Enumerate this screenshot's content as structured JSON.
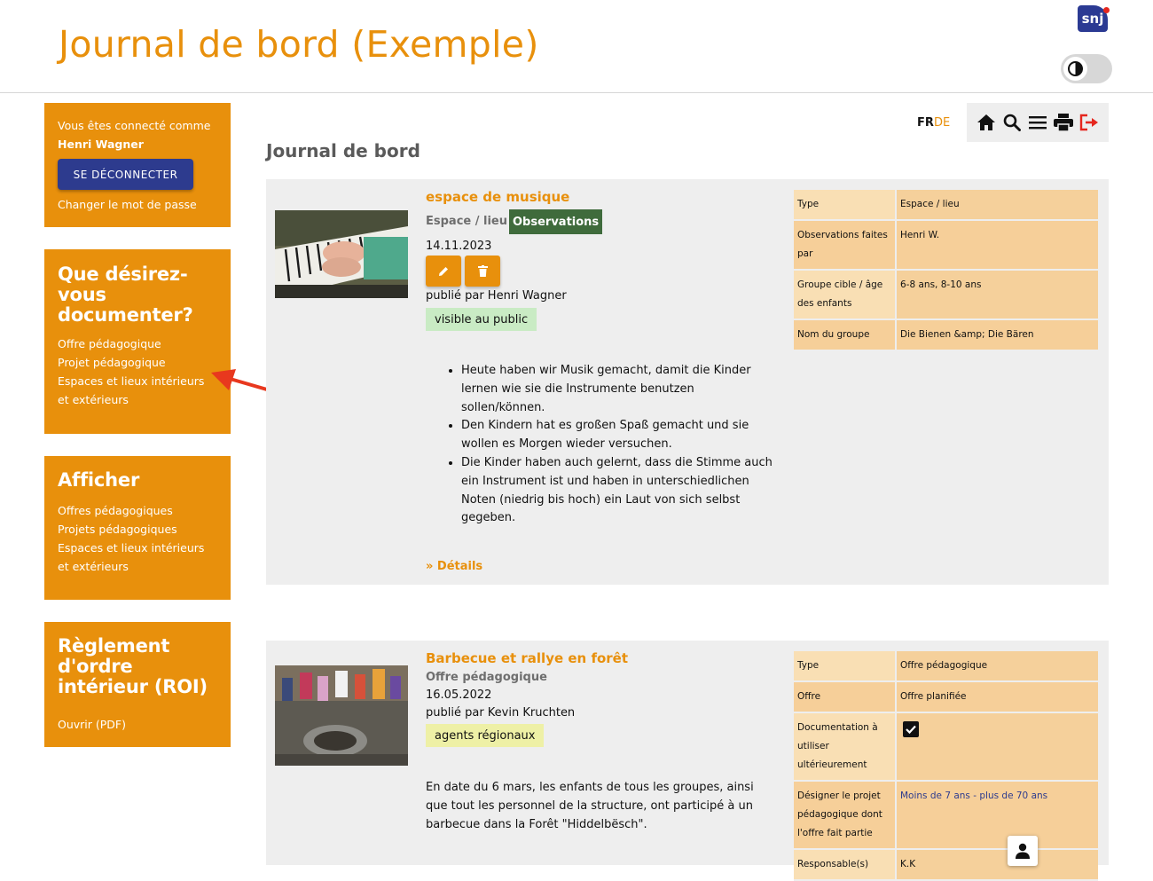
{
  "header": {
    "title": "Journal de bord (Exemple)",
    "logo_text": "snj"
  },
  "sidebar": {
    "login": {
      "line1": "Vous êtes connecté comme",
      "user": "Henri Wagner",
      "logout_label": "SE DÉCONNECTER",
      "change_password": "Changer le mot de passe"
    },
    "document_box": {
      "title": "Que désirez-vous documenter?",
      "items": [
        "Offre pédagogique",
        "Projet pédagogique",
        "Espaces et lieux intérieurs",
        "et extérieurs"
      ]
    },
    "display_box": {
      "title": "Afficher",
      "items": [
        "Offres pédagogiques",
        "Projets pédagogiques",
        "Espaces et lieux intérieurs",
        "et extérieurs"
      ]
    },
    "rules_box": {
      "title": "Règlement d'ordre intérieur (ROI)",
      "link": "Ouvrir (PDF)"
    }
  },
  "toolbar": {
    "lang_fr": "FR",
    "lang_de": "DE",
    "icons": [
      "home-icon",
      "search-icon",
      "menu-icon",
      "print-icon",
      "logout-icon"
    ],
    "logout_color": "#e5261e"
  },
  "main": {
    "heading": "Journal de bord",
    "entries": [
      {
        "title": "espace de musique",
        "category": "Espace / lieu",
        "badge": "Observations",
        "date": "14.11.2023",
        "published_by": "publié par Henri Wagner",
        "visibility": "visible au public",
        "bullets": [
          "Heute haben wir Musik gemacht, damit die Kinder lernen wie sie die Instrumente benutzen sollen/können.",
          "Den Kindern hat es großen Spaß gemacht und sie wollen es Morgen wieder versuchen.",
          "Die Kinder haben auch gelernt, dass die Stimme auch ein Instrument ist und haben in unterschiedlichen Noten (niedrig bis hoch) ein Laut von sich selbst gegeben."
        ],
        "details_link": "» Détails",
        "properties": [
          {
            "key": "Type",
            "value": "Espace / lieu"
          },
          {
            "key": "Observations faites par",
            "value": "Henri W."
          },
          {
            "key": "Groupe cible / âge des enfants",
            "value": "6-8 ans, 8-10 ans"
          },
          {
            "key": "Nom du groupe",
            "value": "Die Bienen &amp; Die Bären"
          }
        ]
      },
      {
        "title": "Barbecue et rallye en forêt",
        "category": "Offre pédagogique",
        "date": "16.05.2022",
        "published_by": "publié par Kevin Kruchten",
        "visibility": "agents régionaux",
        "text": "En date du 6 mars, les enfants de tous les groupes, ainsi que tout les personnel de la structure, ont participé à un barbecue dans la Forêt \"Hiddelbësch\".",
        "properties": [
          {
            "key": "Type",
            "value": "Offre pédagogique"
          },
          {
            "key": "Offre",
            "value": "Offre planifiée"
          },
          {
            "key": "Documentation à utiliser ultérieurement",
            "value": ""
          },
          {
            "key": "Désigner le projet pédagogique dont l'offre fait partie",
            "value": "Moins de 7 ans - plus de 70 ans"
          },
          {
            "key": "Responsable(s)",
            "value": "K.K"
          }
        ]
      }
    ]
  },
  "colors": {
    "accent": "#e8900c",
    "button_blue": "#2d3b8e",
    "badge_green": "#3f6b3c",
    "public_tag": "#c9ebc4",
    "regional_tag": "#eef0a6",
    "arrow": "#e8381e"
  }
}
